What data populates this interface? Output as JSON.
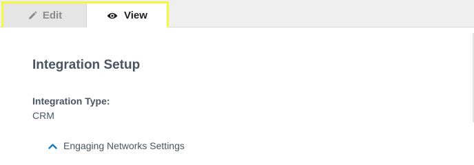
{
  "tabs": {
    "edit": {
      "label": "Edit",
      "icon": "pencil-icon"
    },
    "view": {
      "label": "View",
      "icon": "eye-icon",
      "active": true
    }
  },
  "page": {
    "title": "Integration Setup",
    "integration_type_label": "Integration Type:",
    "integration_type_value": "CRM",
    "section_toggle": {
      "label": "Engaging Networks Settings",
      "icon": "chevron-up-icon"
    }
  },
  "colors": {
    "highlight": "#f4f83c",
    "accent": "#1a7bbd",
    "text": "#4a5561"
  }
}
